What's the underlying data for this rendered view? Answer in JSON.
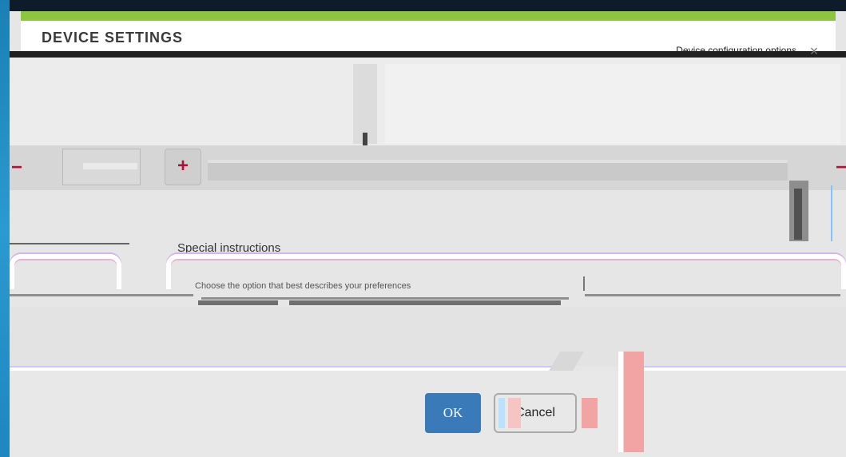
{
  "dialog": {
    "title": "DEVICE SETTINGS",
    "header_right": "Device configuration options",
    "close_label": "×"
  },
  "stepper": {
    "decrement_label": "−",
    "increment_label": "+",
    "right_minus_label": "−"
  },
  "section": {
    "label": "Special instructions"
  },
  "dropdown": {
    "text": "Choose the option that best describes your preferences"
  },
  "footer": {
    "ok_label": "OK",
    "cancel_label": "Cancel"
  },
  "colors": {
    "accent_green": "#8cc63f",
    "primary_button": "#3a7ab8",
    "stepper_sign": "#b0103a",
    "desktop_blue": "#1f86bf"
  }
}
